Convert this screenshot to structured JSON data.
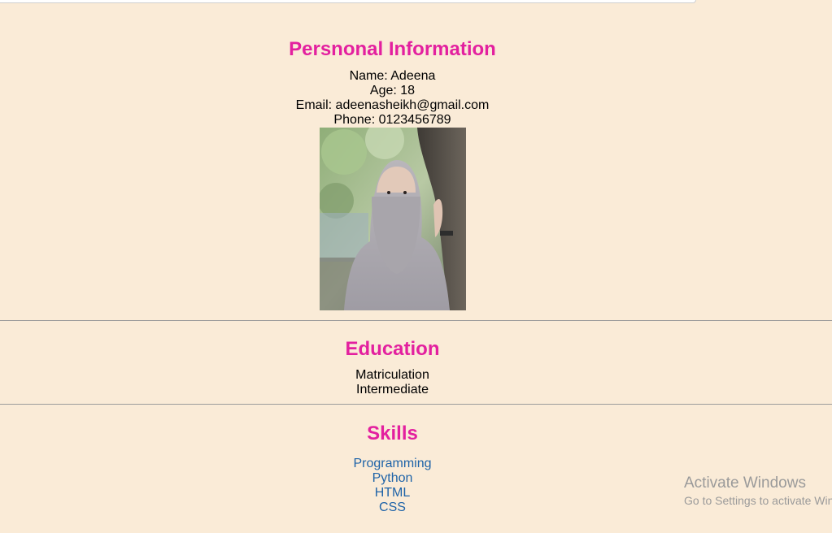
{
  "personal": {
    "heading": "Persnonal Information",
    "name": "Name: Adeena",
    "age": "Age: 18",
    "email": "Email: adeenasheikh@gmail.com",
    "phone": "Phone: 0123456789"
  },
  "education": {
    "heading": "Education",
    "items": [
      "Matriculation",
      "Intermediate"
    ]
  },
  "skills": {
    "heading": "Skills",
    "items": [
      "Programming",
      "Python",
      "HTML",
      "CSS"
    ]
  },
  "watermark": {
    "title": "Activate Windows",
    "subtitle": "Go to Settings to activate Windows."
  },
  "colors": {
    "background": "#FAEBD7",
    "heading": "#E3209F",
    "link": "#1E63A8"
  }
}
